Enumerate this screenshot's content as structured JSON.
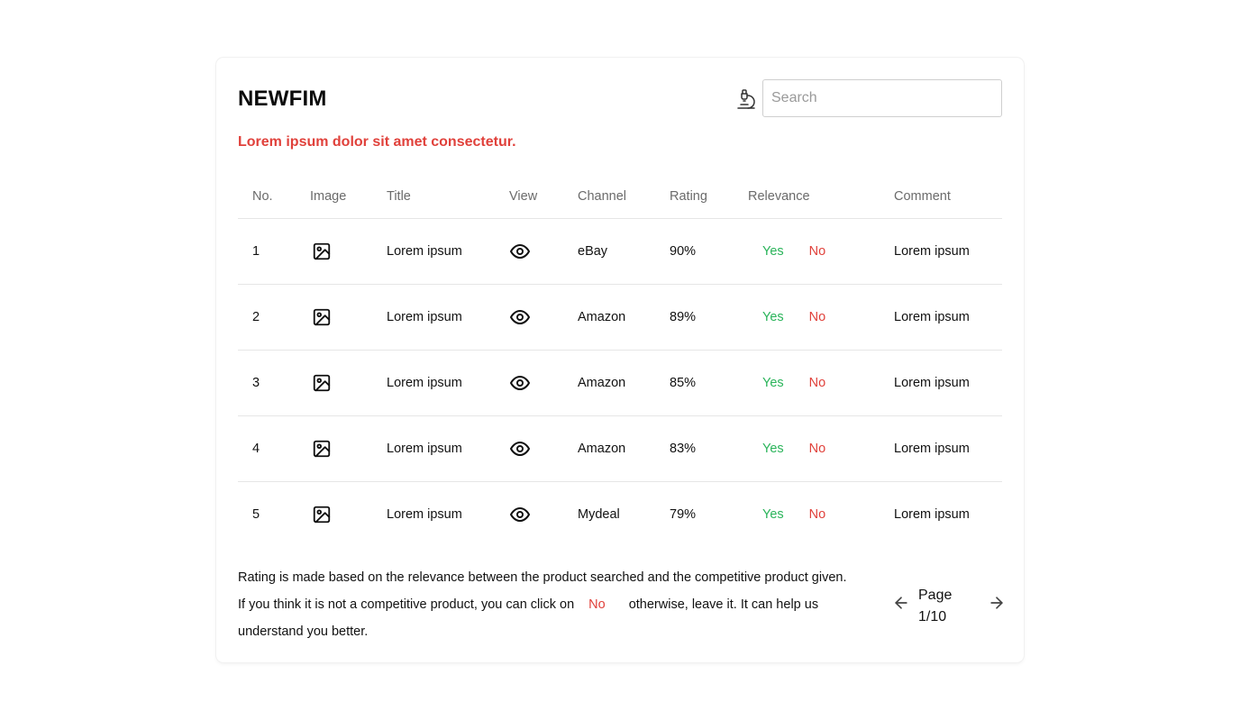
{
  "app": {
    "title": "NEWFIM"
  },
  "search": {
    "placeholder": "Search",
    "value": ""
  },
  "subtitle": "Lorem ipsum dolor sit amet consectetur.",
  "table": {
    "headers": [
      "No.",
      "Image",
      "Title",
      "View",
      "Channel",
      "Rating",
      "Relevance",
      "Comment"
    ],
    "rows": [
      {
        "no": "1",
        "title": "Lorem ipsum",
        "channel": "eBay",
        "rating": "90%",
        "yes": "Yes",
        "no_label": "No",
        "comment": "Lorem ipsum"
      },
      {
        "no": "2",
        "title": "Lorem ipsum",
        "channel": "Amazon",
        "rating": "89%",
        "yes": "Yes",
        "no_label": "No",
        "comment": "Lorem ipsum"
      },
      {
        "no": "3",
        "title": "Lorem ipsum",
        "channel": "Amazon",
        "rating": "85%",
        "yes": "Yes",
        "no_label": "No",
        "comment": "Lorem ipsum"
      },
      {
        "no": "4",
        "title": "Lorem ipsum",
        "channel": "Amazon",
        "rating": "83%",
        "yes": "Yes",
        "no_label": "No",
        "comment": "Lorem ipsum"
      },
      {
        "no": "5",
        "title": "Lorem ipsum",
        "channel": "Mydeal",
        "rating": "79%",
        "yes": "Yes",
        "no_label": "No",
        "comment": "Lorem ipsum"
      }
    ]
  },
  "footer": {
    "line1": "Rating is made based on the relevance between the product searched and the competitive product given.",
    "line2_before": "If you think it is not a competitive product, you can click on",
    "line2_no": "No",
    "line2_after": "otherwise, leave it. It can help us understand you better."
  },
  "pagination": {
    "page_word": "Page",
    "page_value": "1/10"
  },
  "icons": {
    "lab": "microscope-icon",
    "image": "image-icon",
    "view": "eye-icon",
    "prev": "arrow-left-icon",
    "next": "arrow-right-icon"
  },
  "colors": {
    "accent_red": "#e0413b",
    "yes_green": "#2ab45a"
  }
}
